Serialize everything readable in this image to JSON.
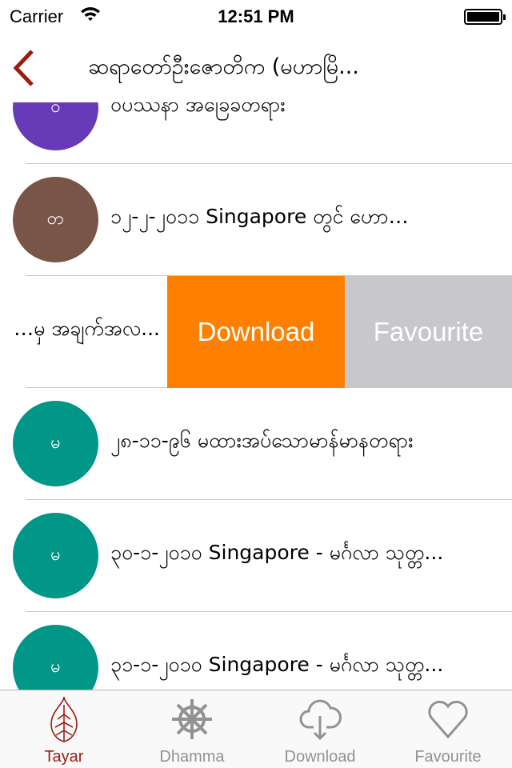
{
  "status_bar": {
    "carrier": "Carrier",
    "time": "12:51 PM",
    "battery_level": 1.0
  },
  "nav": {
    "title": "ဆရာတော်ဦးဇောတိက (မဟာမြိ...",
    "back_color": "#9b1c10"
  },
  "rows": [
    {
      "avatar": "ဝ",
      "avatar_color": "#673ab7",
      "text": "ဝိပဿနာ အခြေခံတရား"
    },
    {
      "avatar": "တ",
      "avatar_color": "#795548",
      "text": "၁၂-၂-၂၀၁၁ Singapore တွင် ဟော…"
    },
    {
      "avatar": "",
      "avatar_color": "#009688",
      "text": "…မှ အချက်အလ..."
    },
    {
      "avatar": "မ",
      "avatar_color": "#009688",
      "text": "၂၈-၁၁-၉၆ မထားအပ်သောမာန်မာနတရား"
    },
    {
      "avatar": "မ",
      "avatar_color": "#009688",
      "text": "၃၀-၁-၂၀၁၀ Singapore - မင်္ဂလာ သုတ္တ..."
    },
    {
      "avatar": "မ",
      "avatar_color": "#009688",
      "text": "၃၁-၁-၂၀၁၀ Singapore - မင်္ဂလာ သုတ္တ..."
    }
  ],
  "swipe_actions": {
    "download": "Download",
    "download_color": "#ff8000",
    "favourite": "Favourite",
    "favourite_color": "#c7c7cc"
  },
  "tabs": [
    {
      "label": "Tayar",
      "icon": "bodhi-leaf-icon",
      "active": true
    },
    {
      "label": "Dhamma",
      "icon": "dharma-wheel-icon",
      "active": false
    },
    {
      "label": "Download",
      "icon": "cloud-download-icon",
      "active": false
    },
    {
      "label": "Favourite",
      "icon": "heart-icon",
      "active": false
    }
  ]
}
